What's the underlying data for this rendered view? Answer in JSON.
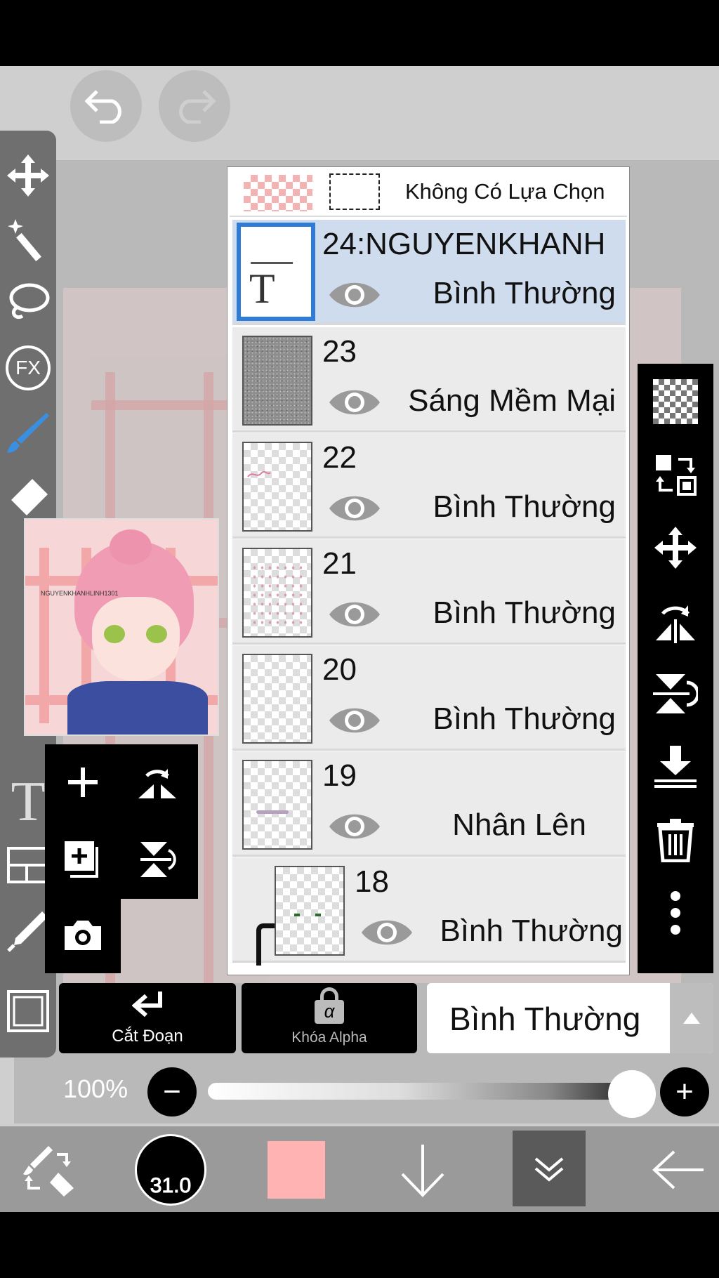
{
  "toolbar_top": {
    "undo_icon": "undo-icon",
    "redo_icon": "redo-icon"
  },
  "tools": [
    {
      "name": "transform-tool",
      "icon": "move-arrows-icon"
    },
    {
      "name": "magic-wand-tool",
      "icon": "magic-wand-icon"
    },
    {
      "name": "lasso-tool",
      "icon": "lasso-icon"
    },
    {
      "name": "filter-tool",
      "icon": "fx-icon",
      "label": "FX"
    },
    {
      "name": "brush-tool",
      "icon": "brush-icon"
    },
    {
      "name": "eraser-tool",
      "icon": "eraser-icon"
    },
    {
      "name": "text-tool",
      "icon": "text-icon",
      "label": "T"
    },
    {
      "name": "frame-tool",
      "icon": "frame-icon"
    },
    {
      "name": "eyedropper-tool",
      "icon": "eyedropper-icon"
    },
    {
      "name": "canvas-tool",
      "icon": "canvas-icon"
    }
  ],
  "selection_row": {
    "label": "Không Có Lựa Chọn"
  },
  "layers": [
    {
      "name": "24:NGUYENKHANH",
      "blend": "Bình Thường",
      "type": "text",
      "active": true
    },
    {
      "name": "23",
      "blend": "Sáng Mềm Mại",
      "type": "noise",
      "active": false
    },
    {
      "name": "22",
      "blend": "Bình Thường",
      "type": "transparent",
      "active": false
    },
    {
      "name": "21",
      "blend": "Bình Thường",
      "type": "transparent",
      "active": false
    },
    {
      "name": "20",
      "blend": "Bình Thường",
      "type": "transparent",
      "active": false
    },
    {
      "name": "19",
      "blend": "Nhân Lên",
      "type": "transparent",
      "active": false
    },
    {
      "name": "18",
      "blend": "Bình Thường",
      "type": "transparent",
      "active": false,
      "clipped": true
    }
  ],
  "right_actions": [
    "transparent-layer-icon",
    "layer-swap-icon",
    "move-icon",
    "flip-horizontal-icon",
    "flip-vertical-icon",
    "merge-down-icon",
    "trash-icon",
    "more-icon"
  ],
  "quick_actions": [
    "add-layer-icon",
    "flip-rotate-icon",
    "duplicate-layer-icon",
    "flip-vertical-icon",
    "camera-icon"
  ],
  "controls": {
    "clipping_label": "Cắt Đoạn",
    "alpha_lock_label": "Khóa Alpha",
    "alpha_symbol": "α",
    "blend_mode_value": "Bình Thường"
  },
  "opacity": {
    "label": "100%",
    "value": 1.0,
    "minus": "−",
    "plus": "+"
  },
  "bottom_bar": {
    "brush_size": "31.0",
    "color": "#ffb3b3"
  },
  "reference_text": "NGUYENKHANHLINH1301"
}
